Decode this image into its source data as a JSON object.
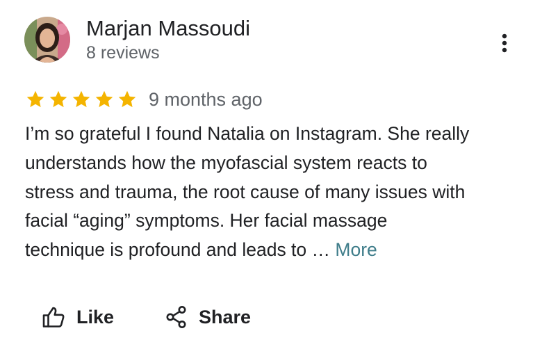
{
  "review": {
    "reviewer": {
      "name": "Marjan Massoudi",
      "review_count": "8 reviews"
    },
    "rating": 5,
    "max_rating": 5,
    "date": "9 months ago",
    "text_lines": [
      "I’m so grateful I found Natalia on Instagram. She really",
      "understands how the myofascial system reacts to",
      "stress and trauma, the root cause of many issues with",
      "facial “aging” symptoms. Her facial massage",
      "technique is profound and leads to … "
    ],
    "more_label": "More"
  },
  "actions": {
    "like_label": "Like",
    "share_label": "Share"
  },
  "icons": {
    "menu": "more-vert-icon",
    "like": "thumb-up-outline-icon",
    "share": "share-icon",
    "star": "star-icon"
  },
  "colors": {
    "star": "#f4b400",
    "more_link": "#3f7d8a",
    "secondary_text": "#5f6368",
    "primary_text": "#202124"
  }
}
